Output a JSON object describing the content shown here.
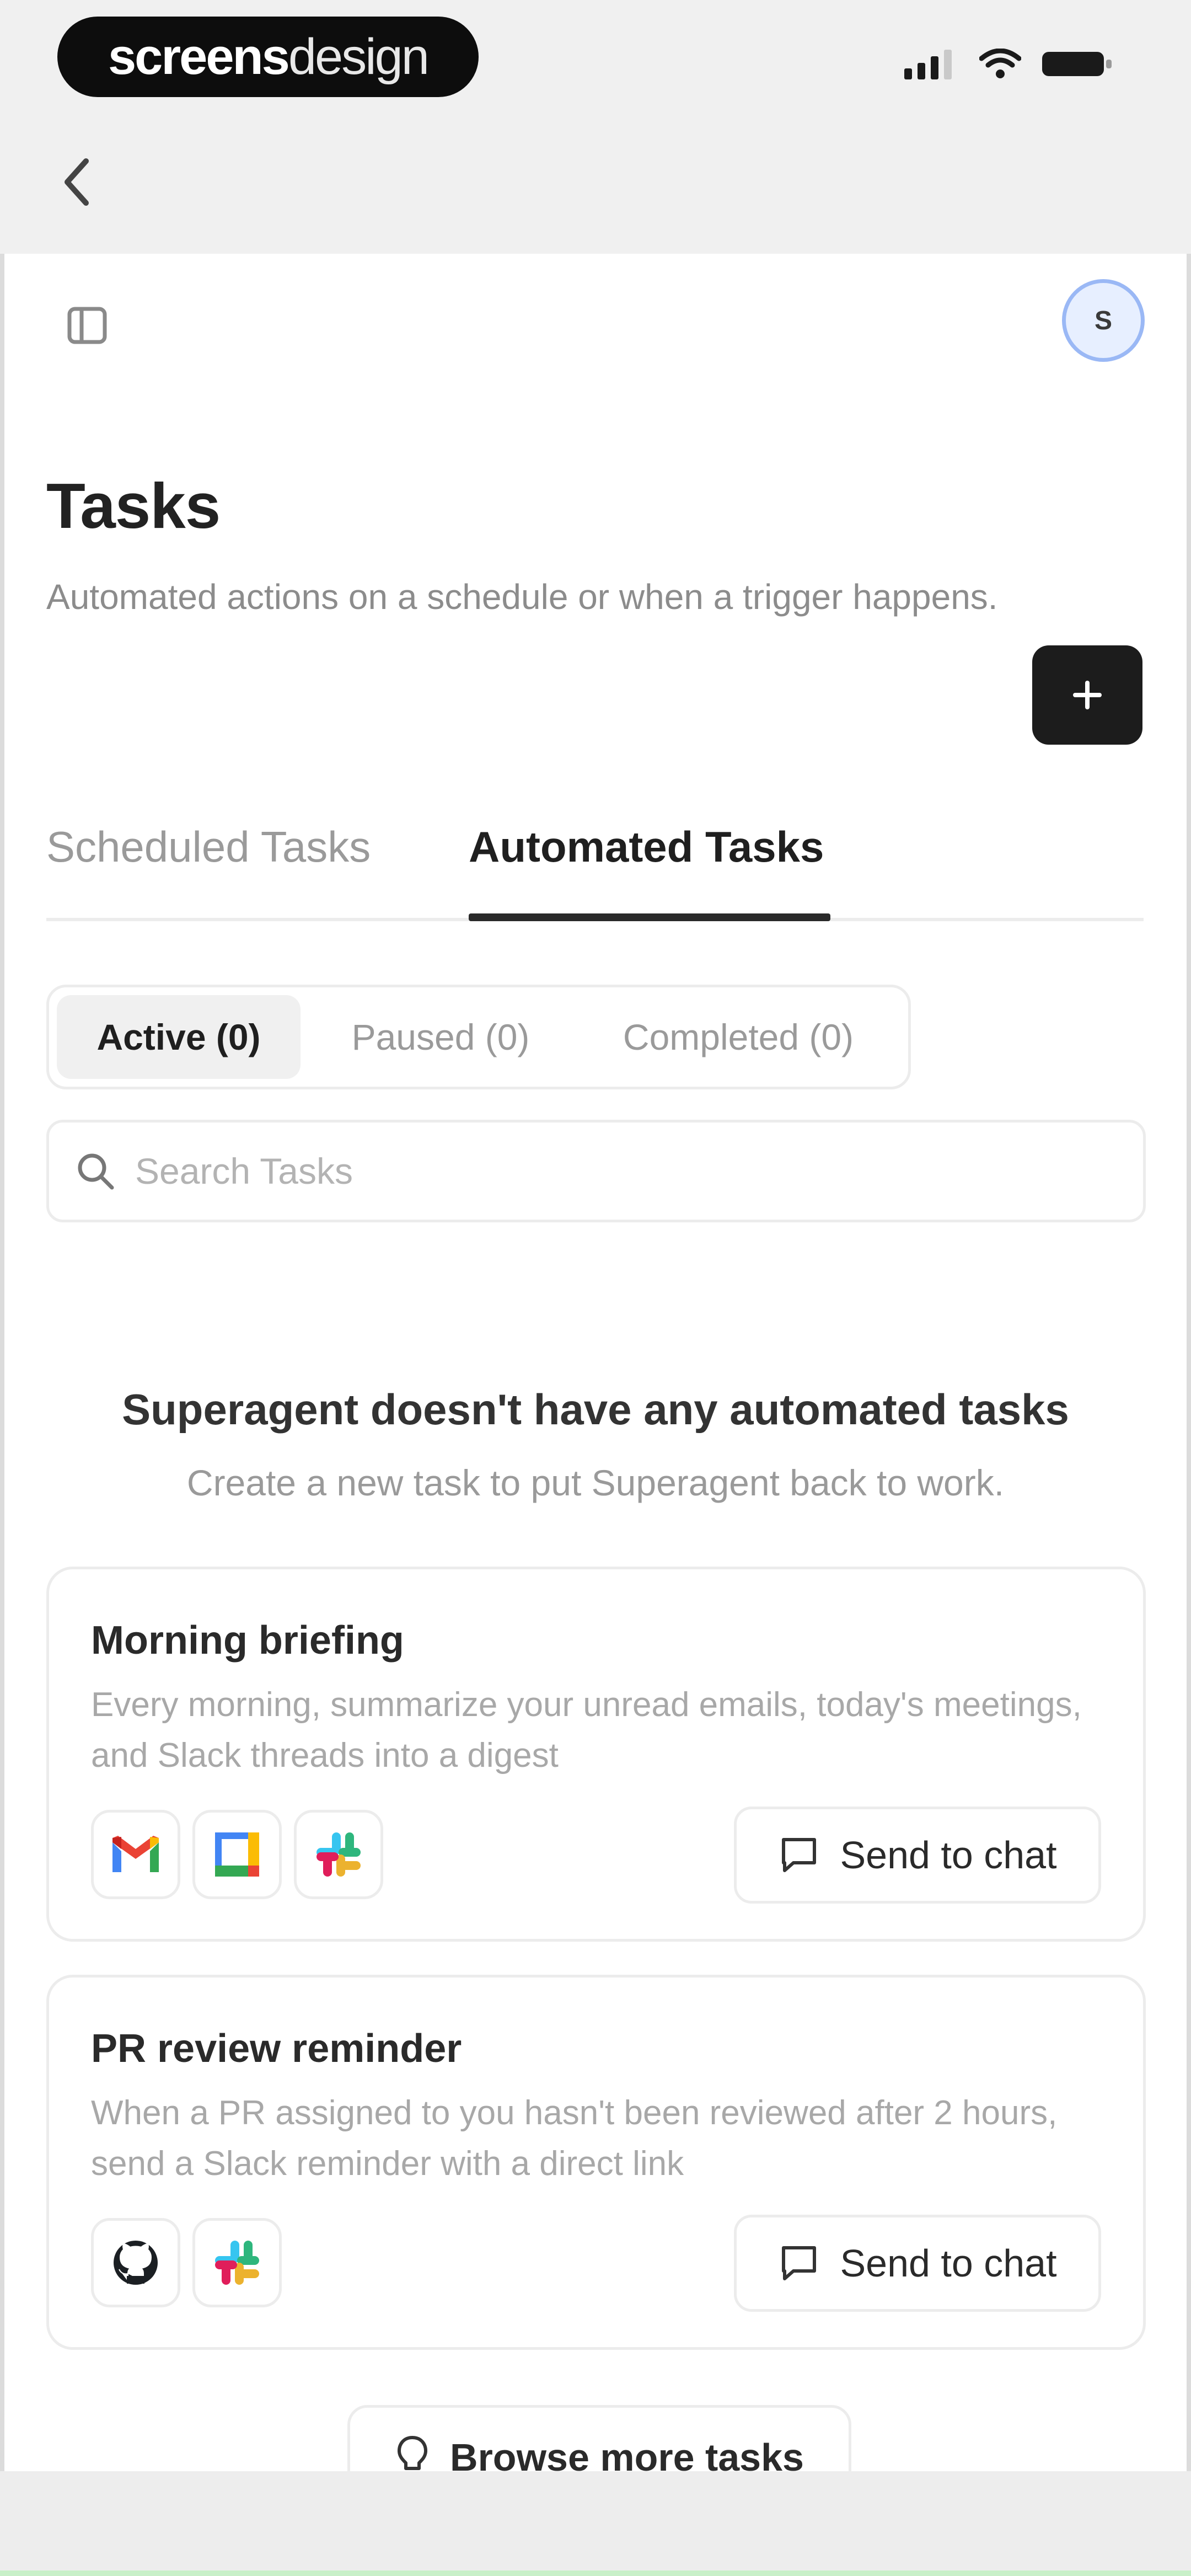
{
  "status_bar": {
    "brand_part1": "screens",
    "brand_part2": "design"
  },
  "header": {
    "avatar_initial": "S"
  },
  "page": {
    "title": "Tasks",
    "subtitle": "Automated actions on a schedule or when a trigger happens."
  },
  "tabs": [
    {
      "label": "Scheduled Tasks",
      "active": false
    },
    {
      "label": "Automated Tasks",
      "active": true
    }
  ],
  "filters": [
    {
      "label": "Active (0)",
      "active": true
    },
    {
      "label": "Paused (0)",
      "active": false
    },
    {
      "label": "Completed (0)",
      "active": false
    }
  ],
  "search": {
    "placeholder": "Search Tasks",
    "value": ""
  },
  "empty_state": {
    "title": "Superagent doesn't have any automated tasks",
    "subtitle": "Create a new task to put Superagent back to work."
  },
  "cards": [
    {
      "title": "Morning briefing",
      "description": "Every morning, summarize your unread emails, today's meetings, and Slack threads into a digest",
      "apps": [
        "gmail-icon",
        "google-calendar-icon",
        "slack-icon"
      ],
      "action_label": "Send to chat"
    },
    {
      "title": "PR review reminder",
      "description": "When a PR assigned to you hasn't been reviewed after 2 hours, send a Slack reminder with a direct link",
      "apps": [
        "github-icon",
        "slack-icon"
      ],
      "action_label": "Send to chat"
    }
  ],
  "browse": {
    "label": "Browse more tasks"
  },
  "colors": {
    "primary_button": "#1c1c1c",
    "avatar_ring": "#9ab8f5",
    "muted_text": "#9a9a9a"
  }
}
